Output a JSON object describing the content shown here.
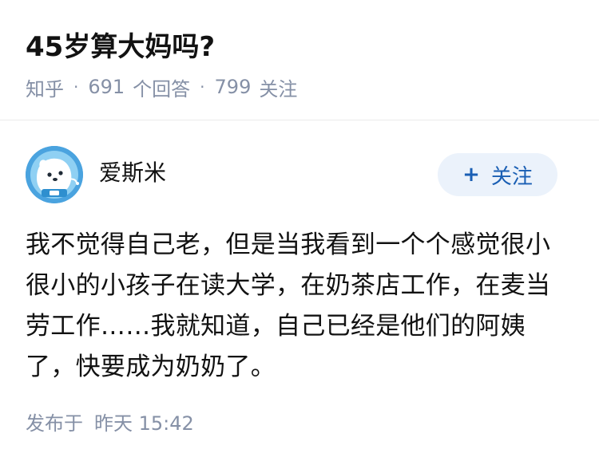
{
  "question": {
    "title": "45岁算大妈吗?",
    "source": "知乎",
    "answer_count": "691",
    "answer_label": "个回答",
    "follower_count": "799",
    "follower_label": "关注"
  },
  "answer": {
    "author_name": "爱斯米",
    "follow_button_label": "关注",
    "follow_button_icon": "plus-icon",
    "content": "我不觉得自己老，但是当我看到一个个感觉很小很小的小孩子在读大学，在奶茶店工作，在麦当劳工作……我就知道，自己已经是他们的阿姨了，快要成为奶奶了。",
    "published_label": "发布于",
    "published_time": "昨天 15:42"
  },
  "colors": {
    "text_primary": "#121212",
    "text_secondary": "#8590a6",
    "follow_button_bg": "#ebf2fb",
    "follow_button_text": "#1a5fb4",
    "avatar_bg": "#4aa3df"
  }
}
